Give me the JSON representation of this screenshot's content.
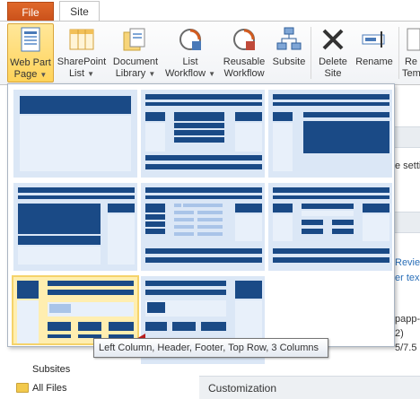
{
  "tabs": {
    "file": "File",
    "site": "Site"
  },
  "ribbon": {
    "web_part_page": [
      "Web Part",
      "Page"
    ],
    "sharepoint_list": [
      "SharePoint",
      "List"
    ],
    "document_library": [
      "Document",
      "Library"
    ],
    "list_workflow": [
      "List",
      "Workflow"
    ],
    "reusable_workflow": [
      "Reusable",
      "Workflow"
    ],
    "subsite": [
      "Subsite"
    ],
    "delete_site": [
      "Delete",
      "Site"
    ],
    "rename": [
      "Rename"
    ],
    "reset_template": [
      "Re",
      "Tem"
    ]
  },
  "background": {
    "settings_text": "e setti",
    "review_link": "Review",
    "text_link": "er tex",
    "app_text": "papp-t",
    "num_text": "2)",
    "version_text": "5/7.5"
  },
  "leftnav": {
    "subsites": "Subsites",
    "all_files": "All Files"
  },
  "customization": "Customization",
  "tooltip": "Left Column, Header, Footer, Top Row, 3 Columns",
  "colors": {
    "accent_orange": "#d25b1f",
    "layout_dark": "#1a4a86",
    "layout_light": "#dbe7f6",
    "selection": "#ffeeb0"
  }
}
